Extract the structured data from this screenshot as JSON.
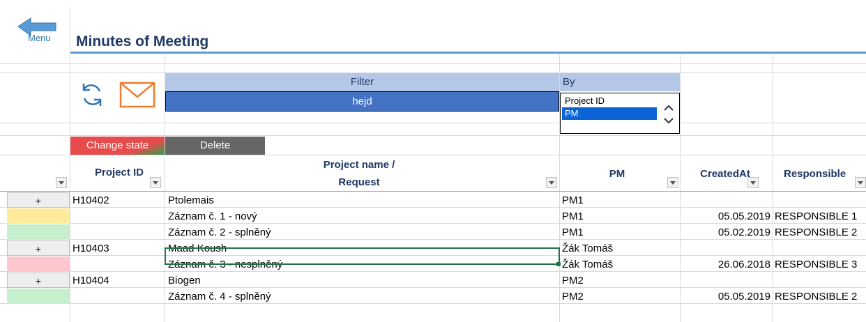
{
  "nav": {
    "back_label": "Menu"
  },
  "page": {
    "title": "Minutes of Meeting"
  },
  "toolbar": {
    "refresh_icon": "refresh-icon",
    "email_icon": "envelope-icon"
  },
  "filter": {
    "label": "Filter",
    "value": "hejd"
  },
  "by": {
    "label": "By",
    "options": [
      "Project ID",
      "PM"
    ],
    "selected": "PM"
  },
  "actions": {
    "change_state": "Change state",
    "delete": "Delete"
  },
  "columns": {
    "project_id": "Project ID",
    "project_name_line1": "Project name /",
    "project_name_line2": "Request",
    "pm": "PM",
    "created_at": "CreatedAt",
    "responsible": "Responsible"
  },
  "rows": [
    {
      "button": "+",
      "button_color": "#eeeeee",
      "project_id": "H10402",
      "name": "Ptolemais",
      "pm": "PM1",
      "created_at": "",
      "responsible": ""
    },
    {
      "button": "",
      "button_color": "#ffeb9c",
      "project_id": "",
      "name": "Záznam č. 1 - nový",
      "pm": "PM1",
      "created_at": "05.05.2019",
      "responsible": "RESPONSIBLE 1"
    },
    {
      "button": "",
      "button_color": "#c6efce",
      "project_id": "",
      "name": "Záznam č. 2 - splněný",
      "pm": "PM1",
      "created_at": "05.02.2019",
      "responsible": "RESPONSIBLE 2"
    },
    {
      "button": "+",
      "button_color": "#eeeeee",
      "project_id": "H10403",
      "name": "Maad Koush",
      "pm": "Žák Tomáš",
      "created_at": "",
      "responsible": ""
    },
    {
      "button": "",
      "button_color": "#ffc7ce",
      "project_id": "",
      "name": "Záznam č. 3 - nesplněný",
      "pm": "Žák Tomáš",
      "created_at": "26.06.2018",
      "responsible": "RESPONSIBLE 3"
    },
    {
      "button": "+",
      "button_color": "#eeeeee",
      "project_id": "H10404",
      "name": "Biogen",
      "pm": "PM2",
      "created_at": "",
      "responsible": ""
    },
    {
      "button": "",
      "button_color": "#c6efce",
      "project_id": "",
      "name": "Záznam č. 4 - splněný",
      "pm": "PM2",
      "created_at": "05.05.2019",
      "responsible": "RESPONSIBLE 2"
    }
  ],
  "colors": {
    "accent": "#4472c4",
    "header_fill": "#b4c7e7",
    "title": "#1f3864",
    "selection": "#217346"
  }
}
